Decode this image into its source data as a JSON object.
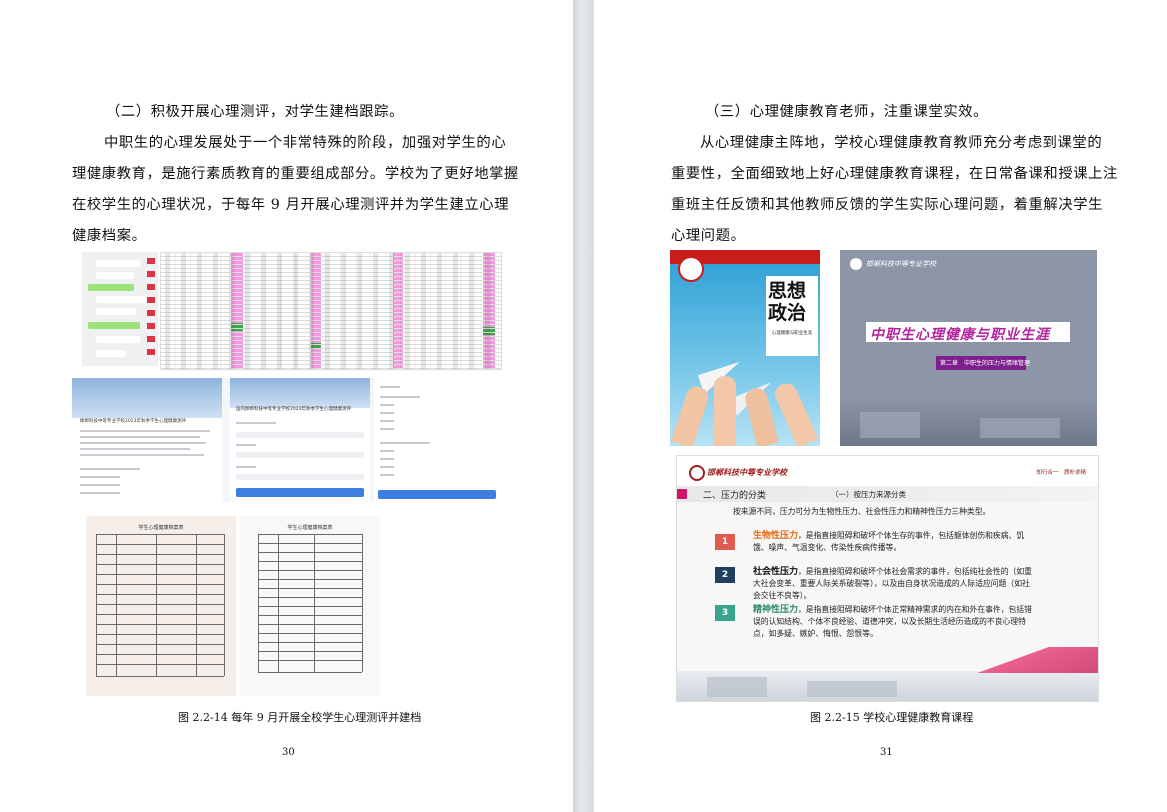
{
  "left_page": {
    "heading": "（二）积极开展心理测评，对学生建档跟踪。",
    "lines": [
      "中职生的心理发展处于一个非常特殊的阶段，加强对学生的心",
      "理健康教育，是施行素质教育的重要组成部分。学校为了更好地掌握",
      "在校学生的心理状况，于每年 9 月开展心理测评并为学生建立心理",
      "健康档案。"
    ],
    "form_left_title": "邯郸科技中等专业学校2023年秋季学生心理健康测评",
    "form_mid_title": "国内邯郸科技中等专业学校2023年秋季学生心理健康测评",
    "doc1_title": "学生心理健康档案表",
    "doc2_title": "学生心理健康档案表",
    "caption": "图 2.2-14 每年 9 月开展全校学生心理测评并建档",
    "page_number": "30"
  },
  "right_page": {
    "heading": "（三）心理健康教育老师，注重课堂实效。",
    "lines": [
      "从心理健康主阵地，学校心理健康教育教师充分考虑到课堂的",
      "重要性，全面细致地上好心理健康教育课程，在日常备课和授课上注",
      "重班主任反馈和其他教师反馈的学生实际心理问题，着重解决学生",
      "心理问题。"
    ],
    "book": {
      "title_line1": "思想",
      "title_line2": "政治",
      "subtitle": "心理健康与职业生涯"
    },
    "slide1": {
      "school": "邯郸科技中等专业学校",
      "title": "中职生心理健康与职业生涯",
      "chapter": "第二章　中职生的压力与情绪管理"
    },
    "slide2": {
      "school": "邯郸科技中等专业学校",
      "motto": "知行合一　质朴求精",
      "section": "二、压力的分类",
      "sub": "（一）按压力来源分类",
      "intro": "按来源不同，压力可分为生物性压力、社会性压力和精神性压力三种类型。",
      "items": [
        {
          "num": "1",
          "name": "生物性压力",
          "text": "，是指直接阻碍和破坏个体生存的事件，包括躯体创伤和疾病、饥饿、噪声、气温变化、传染性疾病传播等。"
        },
        {
          "num": "2",
          "name": "社会性压力",
          "text": "，是指直接阻碍和破坏个体社会需求的事件，包括纯社会性的（如重大社会变革、重要人际关系破裂等），以及由自身状况造成的人际适应问题（如社会交往不良等）。"
        },
        {
          "num": "3",
          "name": "精神性压力",
          "text": "，是指直接阻碍和破坏个体正常精神需求的内在和外在事件，包括错误的认知结构、个体不良经验、道德冲突，以及长期生活经历造成的不良心理特点，如多疑、嫉妒、悔恨、怨恨等。"
        }
      ]
    },
    "caption": "图 2.2-15 学校心理健康教育课程",
    "page_number": "31"
  },
  "colors": {
    "tag1": "#e15a4f",
    "tag2": "#1f3f63",
    "tag3": "#3aa58e",
    "accent_orange": "#e26b12"
  }
}
